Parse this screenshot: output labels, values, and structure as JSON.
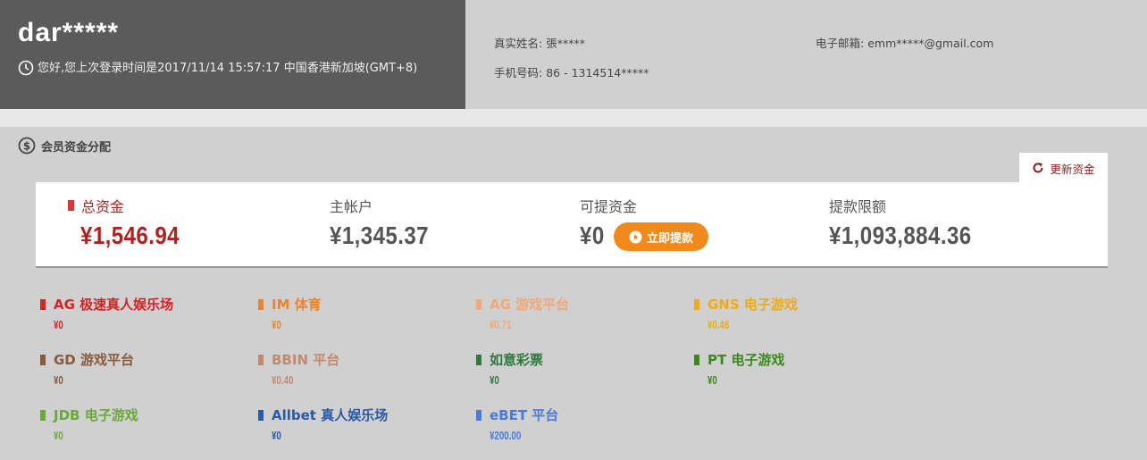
{
  "profile": {
    "username": "dar*****",
    "last_login": "您好,您上次登录时间是2017/11/14 15:57:17 中国香港新加坡(GMT+8)",
    "name_label": "真实姓名:",
    "name_value": "張*****",
    "email_label": "电子邮箱:",
    "email_value": "emm*****@gmail.com",
    "phone_label": "手机号码:",
    "phone_value": "86 - 1314514*****"
  },
  "funds": {
    "section_title": "会员资金分配",
    "refresh_label": "更新资金",
    "total_label": "总资金",
    "total_value": "¥1,546.94",
    "main_label": "主帐户",
    "main_value": "¥1,345.37",
    "withdrawable_label": "可提资金",
    "withdrawable_value": "¥0",
    "withdraw_button": "立即提款",
    "limit_label": "提款限额",
    "limit_value": "¥1,093,884.36",
    "accent_color": "#b32020"
  },
  "platforms": [
    {
      "name": "AG 极速真人娱乐场",
      "amount": "¥0",
      "color": "#d02626"
    },
    {
      "name": "IM 体育",
      "amount": "¥0",
      "color": "#e8862f"
    },
    {
      "name": "AG 游戏平台",
      "amount": "¥0.71",
      "color": "#f0a878"
    },
    {
      "name": "GNS 电子游戏",
      "amount": "¥0.46",
      "color": "#f0a81c"
    },
    {
      "name": "GD 游戏平台",
      "amount": "¥0",
      "color": "#8a5a3a"
    },
    {
      "name": "BBIN 平台",
      "amount": "¥0.40",
      "color": "#c08a70"
    },
    {
      "name": "如意彩票",
      "amount": "¥0",
      "color": "#2e7a3e"
    },
    {
      "name": "PT 电子游戏",
      "amount": "¥0",
      "color": "#3a8a1e"
    },
    {
      "name": "JDB 电子游戏",
      "amount": "¥0",
      "color": "#6aa83a"
    },
    {
      "name": "Allbet 真人娱乐场",
      "amount": "¥0",
      "color": "#2a5aa8"
    },
    {
      "name": "eBET 平台",
      "amount": "¥200.00",
      "color": "#4a7ad8"
    }
  ]
}
